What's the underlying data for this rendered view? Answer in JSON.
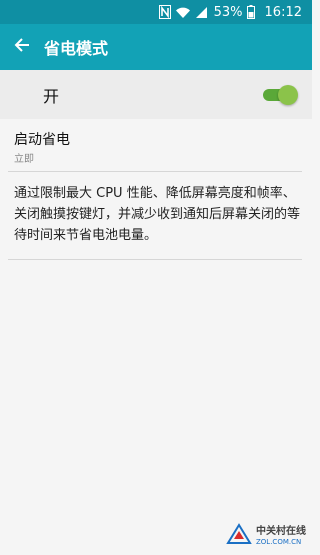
{
  "status_bar": {
    "battery_percent": "53%",
    "time": "16:12",
    "icons": [
      "nfc-icon",
      "wifi-icon",
      "signal-icon",
      "battery-icon"
    ]
  },
  "app_bar": {
    "title": "省电模式",
    "back_icon": "arrow-left-icon"
  },
  "master_toggle": {
    "label": "开",
    "checked": true,
    "track_color": "#5aa838",
    "thumb_color": "#8bc34a"
  },
  "start_setting": {
    "title": "启动省电",
    "value": "立即"
  },
  "description": "通过限制最大 CPU 性能、降低屏幕亮度和帧率、关闭触摸按键灯，并减少收到通知后屏幕关闭的等待时间来节省电池电量。",
  "watermark": {
    "name": "中关村在线",
    "url": "ZOL.COM.CN"
  },
  "colors": {
    "status_bar": "#0f8fa3",
    "app_bar": "#12a2b6",
    "background": "#f5f5f5",
    "toggle_row": "#ececec"
  }
}
